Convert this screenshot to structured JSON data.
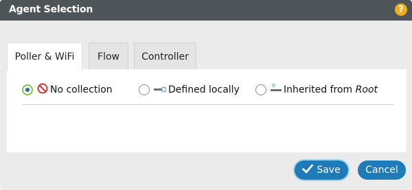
{
  "dialog": {
    "title": "Agent Selection",
    "help_icon": "help-icon",
    "help_glyph": "?"
  },
  "tabs": [
    {
      "label": "Poller & WiFi",
      "active": true
    },
    {
      "label": "Flow",
      "active": false
    },
    {
      "label": "Controller",
      "active": false
    }
  ],
  "options": [
    {
      "label": "No collection",
      "icon": "no-entry-icon",
      "selected": true
    },
    {
      "label": "Defined locally",
      "icon": "local-connector-icon",
      "selected": false
    },
    {
      "label": "Inherited from ",
      "emphasis": "Root",
      "icon": "inherited-connector-icon",
      "selected": false
    }
  ],
  "buttons": {
    "save_label": "Save",
    "cancel_label": "Cancel"
  },
  "colors": {
    "titlebar": "#4d5559",
    "accent": "#1f7ab8",
    "help": "#f0ad1c",
    "radio_selected_ring": "#8bc34a",
    "no_entry": "#d9322b"
  }
}
